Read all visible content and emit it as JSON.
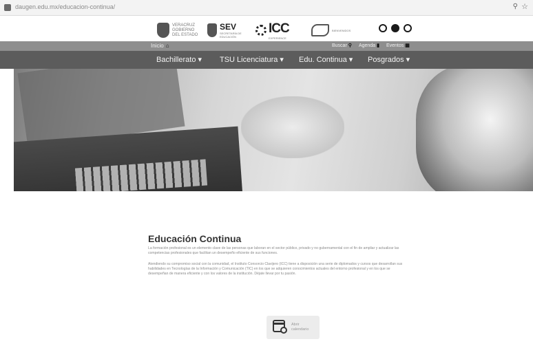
{
  "browser": {
    "url": "daugen.edu.mx/educacion-continua/",
    "zoom_icon": "magnifier-icon",
    "bookmark_icon": "star-icon"
  },
  "logos": {
    "veracruz": "VERACRUZ GOBIERNO DEL ESTADO",
    "sev": "SEV",
    "sev_sub": "SECRETARÍA DE EDUCACIÓN",
    "icc": "ICC",
    "icc_sub": "EXPERIENCE",
    "uv": "BIENVENIDOS"
  },
  "subbar": {
    "home": "Inicio",
    "search": "Buscar",
    "agenda": "Agenda",
    "events": "Eventos"
  },
  "nav": {
    "items": [
      "Bachillerato ▾",
      "TSU Licenciatura ▾",
      "Edu. Continua ▾",
      "Posgrados ▾"
    ]
  },
  "content": {
    "title": "Educación Continua",
    "paragraph1": "La formación profesional es un elemento clave de las personas que laboran en el sector público, privado y no gubernamental con el fin de ampliar y actualizar las competencias profesionales que facilitan un desempeño eficiente de sus funciones.",
    "paragraph2": "Atendiendo su compromiso social con la comunidad, el Instituto Consorcio Clavijero (ICC) tiene a disposición una serie de diplomados y cursos que desarrollan sus habilidades en Tecnologías de la Información y Comunicación (TIC) en los que se adquieren conocimientos actuales del entorno profesional y en los que se desempeñan de manera eficiente y con los valores de la institución. Déjate llevar por tu pasión."
  },
  "calendar_button": {
    "label": "Abrir calendario"
  },
  "colors": {
    "nav": "#5c5c5c",
    "subbar": "#8e8e8e",
    "title": "#333333"
  }
}
